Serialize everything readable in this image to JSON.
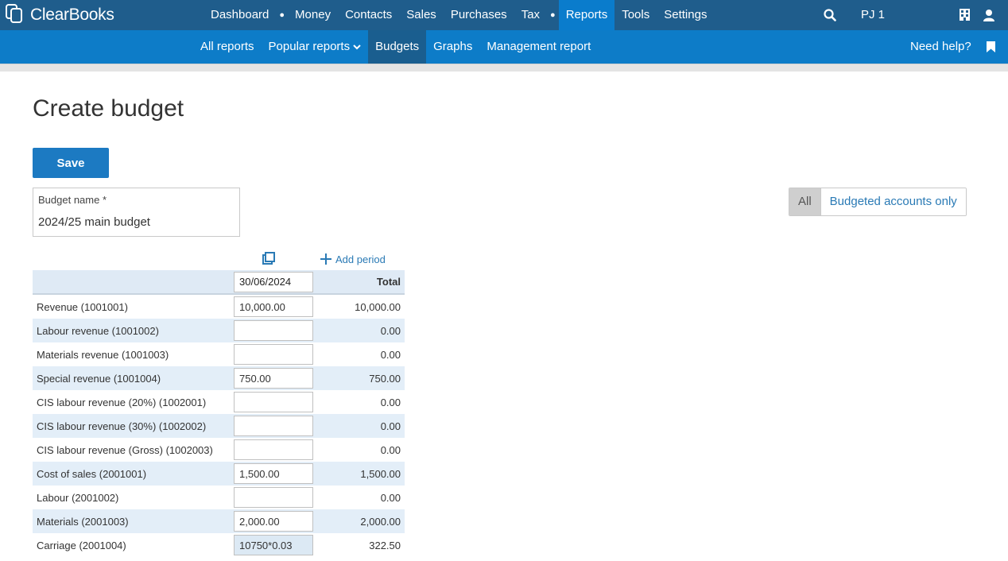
{
  "app": {
    "logo_text": "ClearBooks"
  },
  "topnav": {
    "items": [
      "Dashboard",
      "Money",
      "Contacts",
      "Sales",
      "Purchases",
      "Tax",
      "Reports",
      "Tools",
      "Settings"
    ],
    "active": "Reports",
    "user": "PJ 1"
  },
  "subnav": {
    "items": [
      "All reports",
      "Popular reports",
      "Budgets",
      "Graphs",
      "Management report"
    ],
    "active": "Budgets",
    "help": "Need help?"
  },
  "page": {
    "title": "Create budget",
    "save_label": "Save",
    "budget_name_label": "Budget name *",
    "budget_name_value": "2024/25 main budget",
    "filter": {
      "all_label": "All",
      "budgeted_label": "Budgeted accounts only",
      "selected": "All"
    },
    "add_period_label": "Add period"
  },
  "table": {
    "period_date": "30/06/2024",
    "total_header": "Total",
    "rows": [
      {
        "account": "Revenue (1001001)",
        "value": "10,000.00",
        "total": "10,000.00"
      },
      {
        "account": "Labour revenue (1001002)",
        "value": "",
        "total": "0.00"
      },
      {
        "account": "Materials revenue (1001003)",
        "value": "",
        "total": "0.00"
      },
      {
        "account": "Special revenue (1001004)",
        "value": "750.00",
        "total": "750.00"
      },
      {
        "account": "CIS labour revenue (20%) (1002001)",
        "value": "",
        "total": "0.00"
      },
      {
        "account": "CIS labour revenue (30%) (1002002)",
        "value": "",
        "total": "0.00"
      },
      {
        "account": "CIS labour revenue (Gross) (1002003)",
        "value": "",
        "total": "0.00"
      },
      {
        "account": "Cost of sales (2001001)",
        "value": "1,500.00",
        "total": "1,500.00"
      },
      {
        "account": "Labour (2001002)",
        "value": "",
        "total": "0.00"
      },
      {
        "account": "Materials (2001003)",
        "value": "2,000.00",
        "total": "2,000.00"
      },
      {
        "account": "Carriage (2001004)",
        "value": "10750*0.03",
        "total": "322.50"
      }
    ]
  },
  "colors": {
    "topbar": "#1f5d8c",
    "subbar": "#0d7cc8",
    "accent": "#1c7ac2",
    "row_alt": "#e3eef8"
  }
}
